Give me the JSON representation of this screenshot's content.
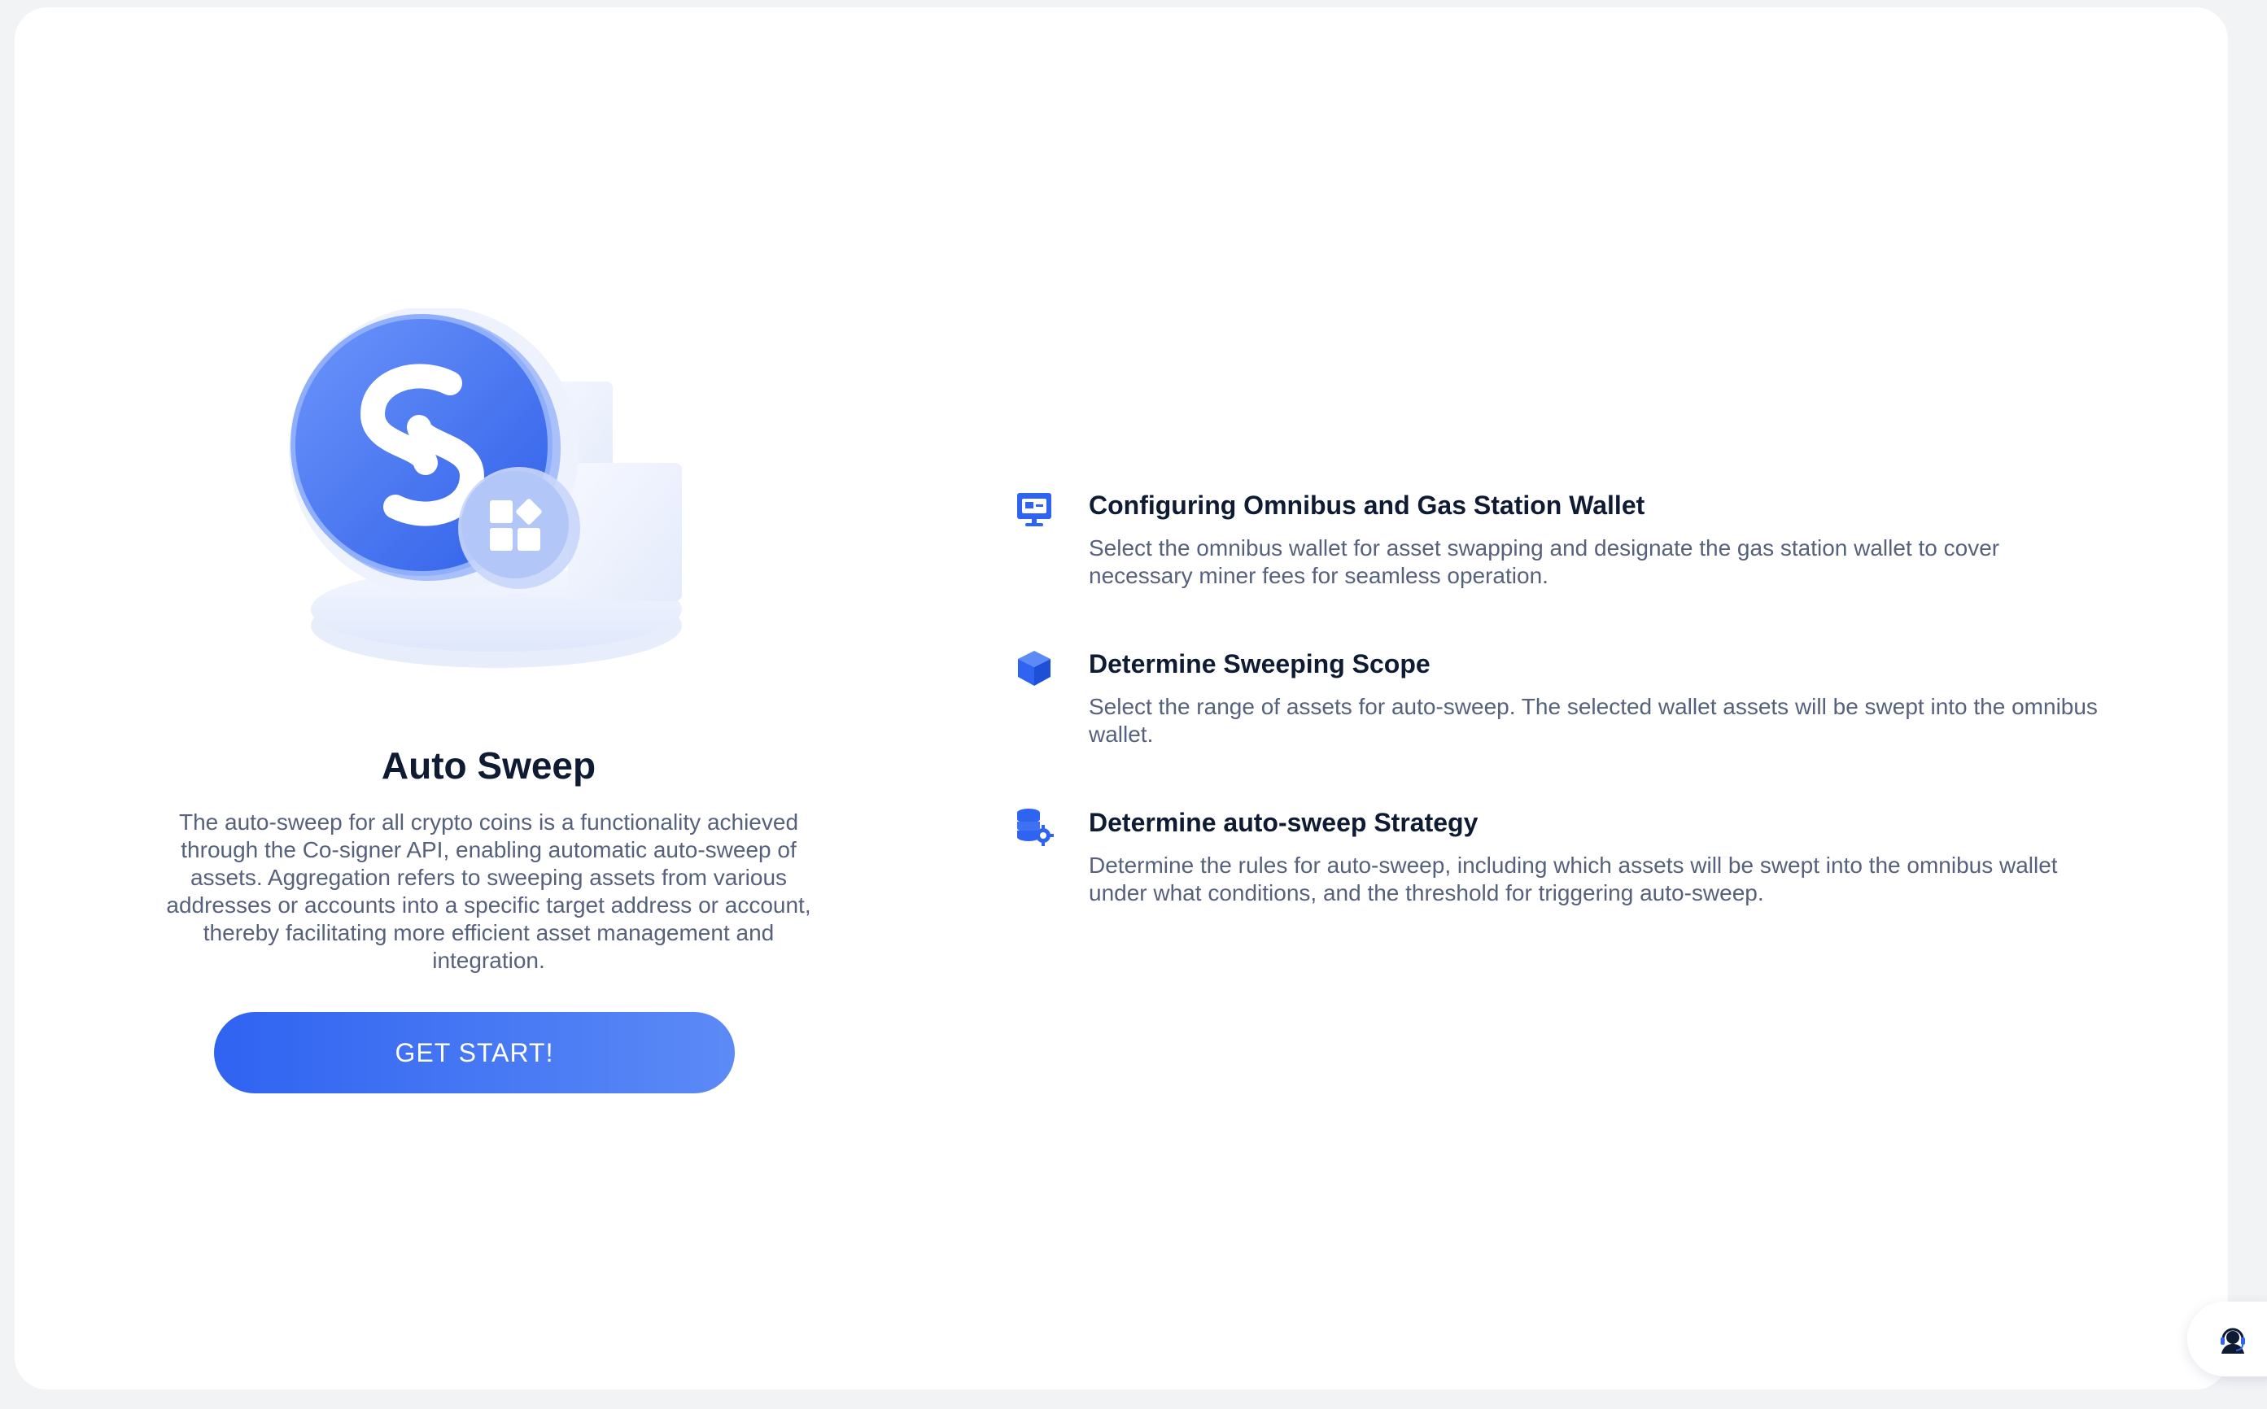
{
  "hero": {
    "title": "Auto Sweep",
    "description": "The auto-sweep for all crypto coins is a functionality achieved through the Co-signer API, enabling automatic auto-sweep of assets. Aggregation refers to sweeping assets from various addresses or accounts into a specific target address or account, thereby facilitating more efficient asset management and integration.",
    "cta_label": "GET START!"
  },
  "features": [
    {
      "icon": "monitor-wallet-icon",
      "title": "Configuring Omnibus and Gas Station Wallet",
      "description": "Select the omnibus wallet for asset swapping and designate the gas station wallet to cover necessary miner fees for seamless operation."
    },
    {
      "icon": "cube-icon",
      "title": "Determine Sweeping Scope",
      "description": "Select the range of assets for auto-sweep. The selected wallet assets will be swept into the omnibus wallet."
    },
    {
      "icon": "database-gear-icon",
      "title": "Determine auto-sweep Strategy",
      "description": "Determine the rules for auto-sweep, including which assets will be swept into the omnibus wallet under what conditions, and the threshold for triggering auto-sweep."
    }
  ],
  "support": {
    "icon": "customer-support-icon"
  },
  "colors": {
    "accent": "#2f63f1",
    "accent_light": "#5c8af6",
    "title": "#0f1a33",
    "body_text": "#56617b",
    "page_bg": "#f2f3f5",
    "card_bg": "#ffffff"
  }
}
